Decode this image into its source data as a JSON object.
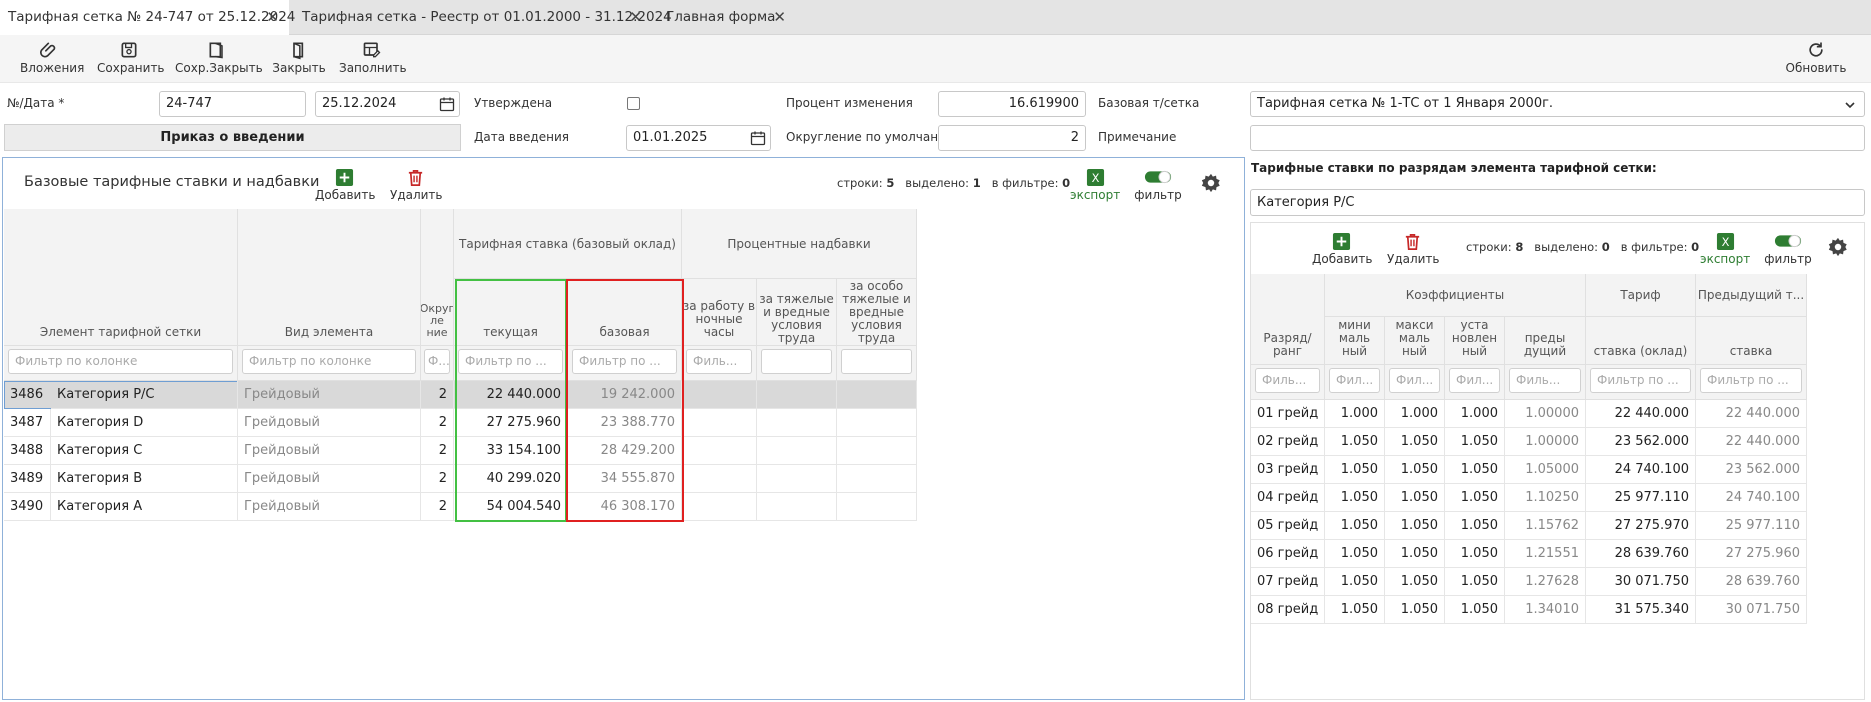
{
  "tabs": [
    {
      "label": "Тарифная сетка № 24-747 от 25.12.2024"
    },
    {
      "label": "Тарифная сетка - Реестр от 01.01.2000 - 31.12.2024"
    },
    {
      "label": "Главная форма"
    }
  ],
  "toolbar": {
    "attachments": "Вложения",
    "save": "Сохранить",
    "save_close": "Сохр.Закрыть",
    "close": "Закрыть",
    "fill": "Заполнить",
    "refresh": "Обновить"
  },
  "form": {
    "num_date_label": "№/Дата *",
    "number": "24-747",
    "date": "25.12.2024",
    "approved_label": "Утверждена",
    "percent_label": "Процент изменения",
    "percent_value": "16.619900",
    "base_grid_label": "Базовая т/сетка",
    "base_grid_value": "Тарифная сетка № 1-ТС от 1 Января 2000г.",
    "order_button": "Приказ о введении",
    "intro_date_label": "Дата введения",
    "intro_date": "01.01.2025",
    "rounding_label": "Округление по умолчан...",
    "rounding_value": "2",
    "note_label": "Примечание",
    "note_value": ""
  },
  "left_panel": {
    "title": "Базовые тарифные ставки и надбавки",
    "add": "Добавить",
    "delete": "Удалить",
    "rows_label": "строки:",
    "rows_count": "5",
    "selected_label": "выделено:",
    "selected_count": "1",
    "filtered_label": "в фильтре:",
    "filtered_count": "0",
    "export": "экспорт",
    "filter": "фильтр",
    "headers": {
      "element": "Элемент тарифной сетки",
      "kind": "Вид элемента",
      "rounding": "Округ ле ние",
      "rate_group": "Тарифная ставка (базовый оклад)",
      "current": "текущая",
      "base": "базовая",
      "bonus_group": "Процентные надбавки",
      "night": "за работу в ночные часы",
      "harmful": "за тяжелые и вредные условия труда",
      "very_harmful": "за особо тяжелые и вредные условия труда"
    },
    "filters": {
      "col": "Фильтр по колонке",
      "short": "Ф...",
      "mid": "Фильтр по ...",
      "night": "Филь..."
    },
    "rows": [
      {
        "id": "3486",
        "name": "Категория Р/С",
        "kind": "Грейдовый",
        "round": "2",
        "current": "22 440.000",
        "base": "19 242.000"
      },
      {
        "id": "3487",
        "name": "Категория D",
        "kind": "Грейдовый",
        "round": "2",
        "current": "27 275.960",
        "base": "23 388.770"
      },
      {
        "id": "3488",
        "name": "Категория C",
        "kind": "Грейдовый",
        "round": "2",
        "current": "33 154.100",
        "base": "28 429.200"
      },
      {
        "id": "3489",
        "name": "Категория B",
        "kind": "Грейдовый",
        "round": "2",
        "current": "40 299.020",
        "base": "34 555.870"
      },
      {
        "id": "3490",
        "name": "Категория A",
        "kind": "Грейдовый",
        "round": "2",
        "current": "54 004.540",
        "base": "46 308.170"
      }
    ]
  },
  "right_panel": {
    "title": "Тарифные ставки по разрядам элемента тарифной сетки:",
    "category": "Категория Р/С",
    "add": "Добавить",
    "delete": "Удалить",
    "rows_label": "строки:",
    "rows_count": "8",
    "selected_label": "выделено:",
    "selected_count": "0",
    "filtered_label": "в фильтре:",
    "filtered_count": "0",
    "export": "экспорт",
    "filter": "фильтр",
    "headers": {
      "rank": "Разряд/ ранг",
      "coef_group": "Коэффициенты",
      "min": "мини маль ный",
      "max": "макси маль ный",
      "set": "уста новлен ный",
      "prev": "преды дущий",
      "tariff_group": "Тариф",
      "rate": "ставка (оклад)",
      "prev_group": "Предыдущий т...",
      "prev_rate": "ставка"
    },
    "filters": {
      "a": "Филь...",
      "b": "Фил...",
      "c": "Фильтр по ...",
      "d": "Фильтр по ..."
    },
    "rows": [
      {
        "rank": "01 грейд",
        "min": "1.000",
        "max": "1.000",
        "set": "1.000",
        "prev": "1.00000",
        "rate": "22 440.000",
        "prev_rate": "22 440.000"
      },
      {
        "rank": "02 грейд",
        "min": "1.050",
        "max": "1.050",
        "set": "1.050",
        "prev": "1.00000",
        "rate": "23 562.000",
        "prev_rate": "22 440.000"
      },
      {
        "rank": "03 грейд",
        "min": "1.050",
        "max": "1.050",
        "set": "1.050",
        "prev": "1.05000",
        "rate": "24 740.100",
        "prev_rate": "23 562.000"
      },
      {
        "rank": "04 грейд",
        "min": "1.050",
        "max": "1.050",
        "set": "1.050",
        "prev": "1.10250",
        "rate": "25 977.110",
        "prev_rate": "24 740.100"
      },
      {
        "rank": "05 грейд",
        "min": "1.050",
        "max": "1.050",
        "set": "1.050",
        "prev": "1.15762",
        "rate": "27 275.970",
        "prev_rate": "25 977.110"
      },
      {
        "rank": "06 грейд",
        "min": "1.050",
        "max": "1.050",
        "set": "1.050",
        "prev": "1.21551",
        "rate": "28 639.760",
        "prev_rate": "27 275.960"
      },
      {
        "rank": "07 грейд",
        "min": "1.050",
        "max": "1.050",
        "set": "1.050",
        "prev": "1.27628",
        "rate": "30 071.750",
        "prev_rate": "28 639.760"
      },
      {
        "rank": "08 грейд",
        "min": "1.050",
        "max": "1.050",
        "set": "1.050",
        "prev": "1.34010",
        "rate": "31 575.340",
        "prev_rate": "30 071.750"
      }
    ]
  },
  "colors": {
    "accent": "#2e7d32",
    "danger": "#c62828",
    "highlight_green": "#43c043",
    "highlight_red": "#e02020",
    "panel_border": "#8fb1d9"
  }
}
